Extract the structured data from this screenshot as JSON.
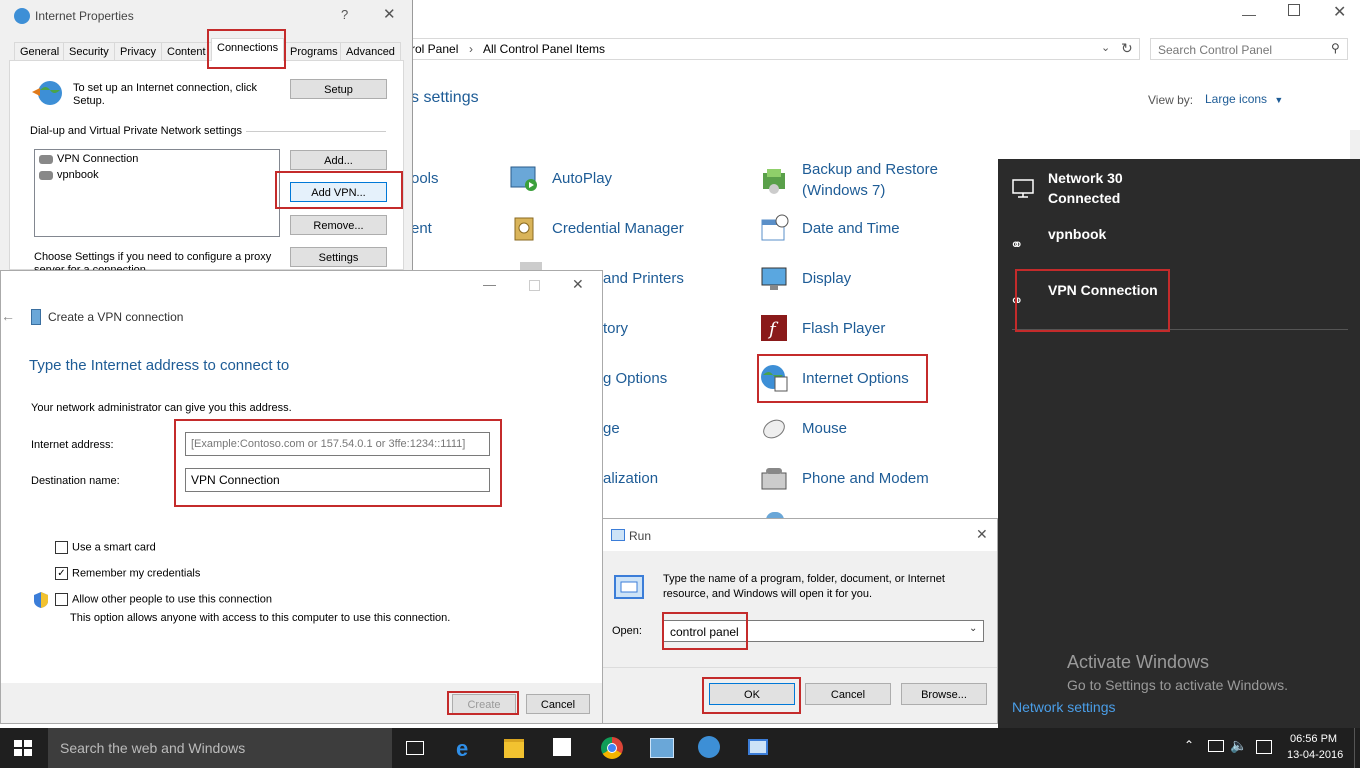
{
  "control_panel": {
    "breadcrumb_1": "rol Panel",
    "breadcrumb_2": "All Control Panel Items",
    "search_placeholder": "Search Control Panel",
    "heading": "s settings",
    "view_by_label": "View by:",
    "view_by_value": "Large icons",
    "partial_items": [
      "ools",
      "ent",
      "and Printers",
      "tory",
      "g Options",
      "ge",
      "alization"
    ],
    "col2": [
      "AutoPlay",
      "Credential Manager"
    ],
    "col3": [
      "Backup and Restore (Windows 7)",
      "Date and Time",
      "Display",
      "Flash Player",
      "Internet Options",
      "Mouse",
      "Phone and Modem"
    ]
  },
  "internet_properties": {
    "title": "Internet Properties",
    "help": "?",
    "tabs": [
      "General",
      "Security",
      "Privacy",
      "Content",
      "Connections",
      "Programs",
      "Advanced"
    ],
    "setup_text": "To set up an Internet connection, click Setup.",
    "setup_button": "Setup",
    "group_label": "Dial-up and Virtual Private Network settings",
    "connections": [
      "VPN Connection",
      "vpnbook"
    ],
    "add_button": "Add...",
    "add_vpn_button": "Add VPN...",
    "remove_button": "Remove...",
    "proxy_text": "Choose Settings if you need to configure a proxy server for a connection.",
    "settings_button": "Settings"
  },
  "vpn_wizard": {
    "title": "Create a VPN connection",
    "heading": "Type the Internet address to connect to",
    "info": "Your network administrator can give you this address.",
    "address_label": "Internet address:",
    "address_placeholder": "[Example:Contoso.com or 157.54.0.1 or 3ffe:1234::1111]",
    "dest_label": "Destination name:",
    "dest_value": "VPN Connection",
    "smart_card": "Use a smart card",
    "remember": "Remember my credentials",
    "allow_others": "Allow other people to use this connection",
    "allow_note": "This option allows anyone with access to this computer to use this connection.",
    "create_button": "Create",
    "cancel_button": "Cancel"
  },
  "run_dialog": {
    "title": "Run",
    "description": "Type the name of a program, folder, document, or Internet resource, and Windows will open it for you.",
    "open_label": "Open:",
    "open_value": "control panel",
    "ok_button": "OK",
    "cancel_button": "Cancel",
    "browse_button": "Browse..."
  },
  "network_flyout": {
    "network_name": "Network 30",
    "network_status": "Connected",
    "vpn1": "vpnbook",
    "vpn2": "VPN Connection",
    "activate_title": "Activate Windows",
    "activate_sub": "Go to Settings to activate Windows.",
    "settings_link": "Network settings"
  },
  "taskbar": {
    "search_placeholder": "Search the web and Windows",
    "time": "06:56 PM",
    "date": "13-04-2016"
  },
  "colors": {
    "accent": "#1e5c96",
    "highlight_red": "#c42b2b",
    "taskbar": "#1f1f1f",
    "flyout": "#2b2b2b"
  }
}
